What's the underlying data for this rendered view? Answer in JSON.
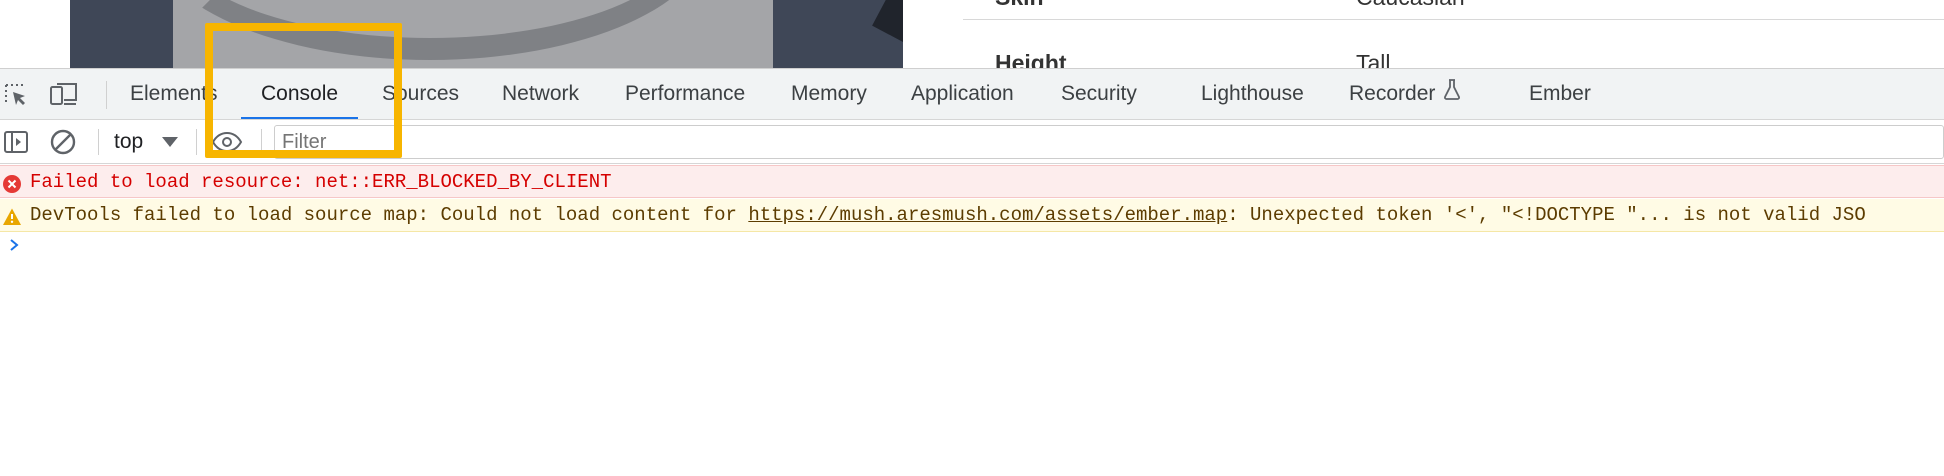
{
  "profile": {
    "cut_label": "Skin",
    "cut_value": "Caucasian",
    "label": "Height",
    "value": "Tall"
  },
  "devtools": {
    "tabs": [
      {
        "label": "Elements",
        "active": false
      },
      {
        "label": "Console",
        "active": true
      },
      {
        "label": "Sources",
        "active": false
      },
      {
        "label": "Network",
        "active": false
      },
      {
        "label": "Performance",
        "active": false
      },
      {
        "label": "Memory",
        "active": false
      },
      {
        "label": "Application",
        "active": false
      },
      {
        "label": "Security",
        "active": false
      },
      {
        "label": "Lighthouse",
        "active": false
      },
      {
        "label": "Recorder",
        "active": false
      },
      {
        "label": "Ember",
        "active": false
      }
    ],
    "icons": [
      "inspect-element-icon",
      "device-toggle-icon",
      "flask-icon"
    ],
    "toolbar": {
      "context": "top",
      "filter_placeholder": "Filter",
      "filter_value": "",
      "icons": [
        "sidebar-toggle-icon",
        "clear-console-icon",
        "dropdown-arrow-icon",
        "eye-icon"
      ]
    }
  },
  "console": {
    "messages": [
      {
        "level": "error",
        "icon": "error-icon",
        "text": "Failed to load resource: net::ERR_BLOCKED_BY_CLIENT"
      },
      {
        "level": "warning",
        "icon": "warning-icon",
        "prefix": "DevTools failed to load source map: Could not load content for ",
        "link": "https://mush.aresmush.com/assets/ember.map",
        "suffix": ": Unexpected token '<', \"<!DOCTYPE \"... is not valid JSO"
      }
    ],
    "prompt_icon": "chevron-right-icon"
  },
  "colors": {
    "highlight": "#f7b500",
    "active_tab_underline": "#1a73e8",
    "error_bg": "#fdeded",
    "error_text": "#d50000",
    "warning_bg": "#fffbe5",
    "warning_icon": "#e8a600"
  }
}
